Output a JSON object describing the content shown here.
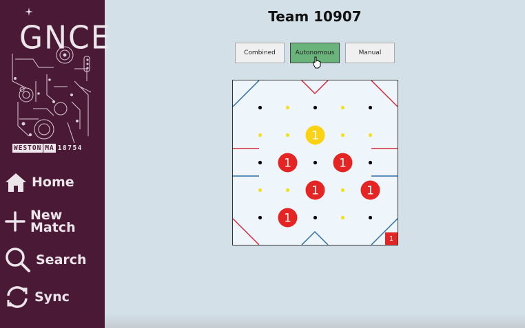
{
  "sidebar": {
    "logo": {
      "letters": "GNCE",
      "town": "WESTON",
      "state": "MA",
      "team_number": "18754"
    },
    "items": [
      {
        "label": "Home",
        "icon": "home-icon"
      },
      {
        "label": "New Match",
        "icon": "plus-icon"
      },
      {
        "label": "Search",
        "icon": "search-icon"
      },
      {
        "label": "Sync",
        "icon": "sync-icon"
      }
    ]
  },
  "main": {
    "title": "Team 10907",
    "tabs": [
      {
        "label": "Combined",
        "active": false
      },
      {
        "label": "Autonomous",
        "active": true
      },
      {
        "label": "Manual",
        "active": false
      }
    ],
    "field": {
      "grid_size": 5,
      "small_dots": [
        {
          "row": 0,
          "col": 0,
          "color": "black"
        },
        {
          "row": 0,
          "col": 1,
          "color": "yellow"
        },
        {
          "row": 0,
          "col": 2,
          "color": "black"
        },
        {
          "row": 0,
          "col": 3,
          "color": "yellow"
        },
        {
          "row": 0,
          "col": 4,
          "color": "black"
        },
        {
          "row": 1,
          "col": 0,
          "color": "yellow"
        },
        {
          "row": 1,
          "col": 1,
          "color": "yellow"
        },
        {
          "row": 1,
          "col": 3,
          "color": "yellow"
        },
        {
          "row": 1,
          "col": 4,
          "color": "yellow"
        },
        {
          "row": 2,
          "col": 0,
          "color": "black"
        },
        {
          "row": 2,
          "col": 2,
          "color": "black"
        },
        {
          "row": 2,
          "col": 4,
          "color": "black"
        },
        {
          "row": 3,
          "col": 0,
          "color": "yellow"
        },
        {
          "row": 3,
          "col": 1,
          "color": "yellow"
        },
        {
          "row": 3,
          "col": 3,
          "color": "yellow"
        },
        {
          "row": 4,
          "col": 0,
          "color": "black"
        },
        {
          "row": 4,
          "col": 2,
          "color": "black"
        },
        {
          "row": 4,
          "col": 3,
          "color": "yellow"
        },
        {
          "row": 4,
          "col": 4,
          "color": "black"
        }
      ],
      "markers": [
        {
          "row": 1,
          "col": 2,
          "color": "yellow",
          "label": "1"
        },
        {
          "row": 2,
          "col": 1,
          "color": "red",
          "label": "1"
        },
        {
          "row": 2,
          "col": 3,
          "color": "red",
          "label": "1"
        },
        {
          "row": 3,
          "col": 2,
          "color": "red",
          "label": "1"
        },
        {
          "row": 3,
          "col": 4,
          "color": "red",
          "label": "1"
        },
        {
          "row": 4,
          "col": 1,
          "color": "red",
          "label": "1"
        }
      ],
      "corner_badge": "1"
    }
  },
  "colors": {
    "sidebar_bg": "#4a1935",
    "main_bg": "#d3e0e8",
    "active_tab": "#6ab47b",
    "marker_red": "#e52424",
    "marker_yellow": "#fcd312",
    "line_blue": "#2b6fa8",
    "line_red": "#d42a3a"
  }
}
